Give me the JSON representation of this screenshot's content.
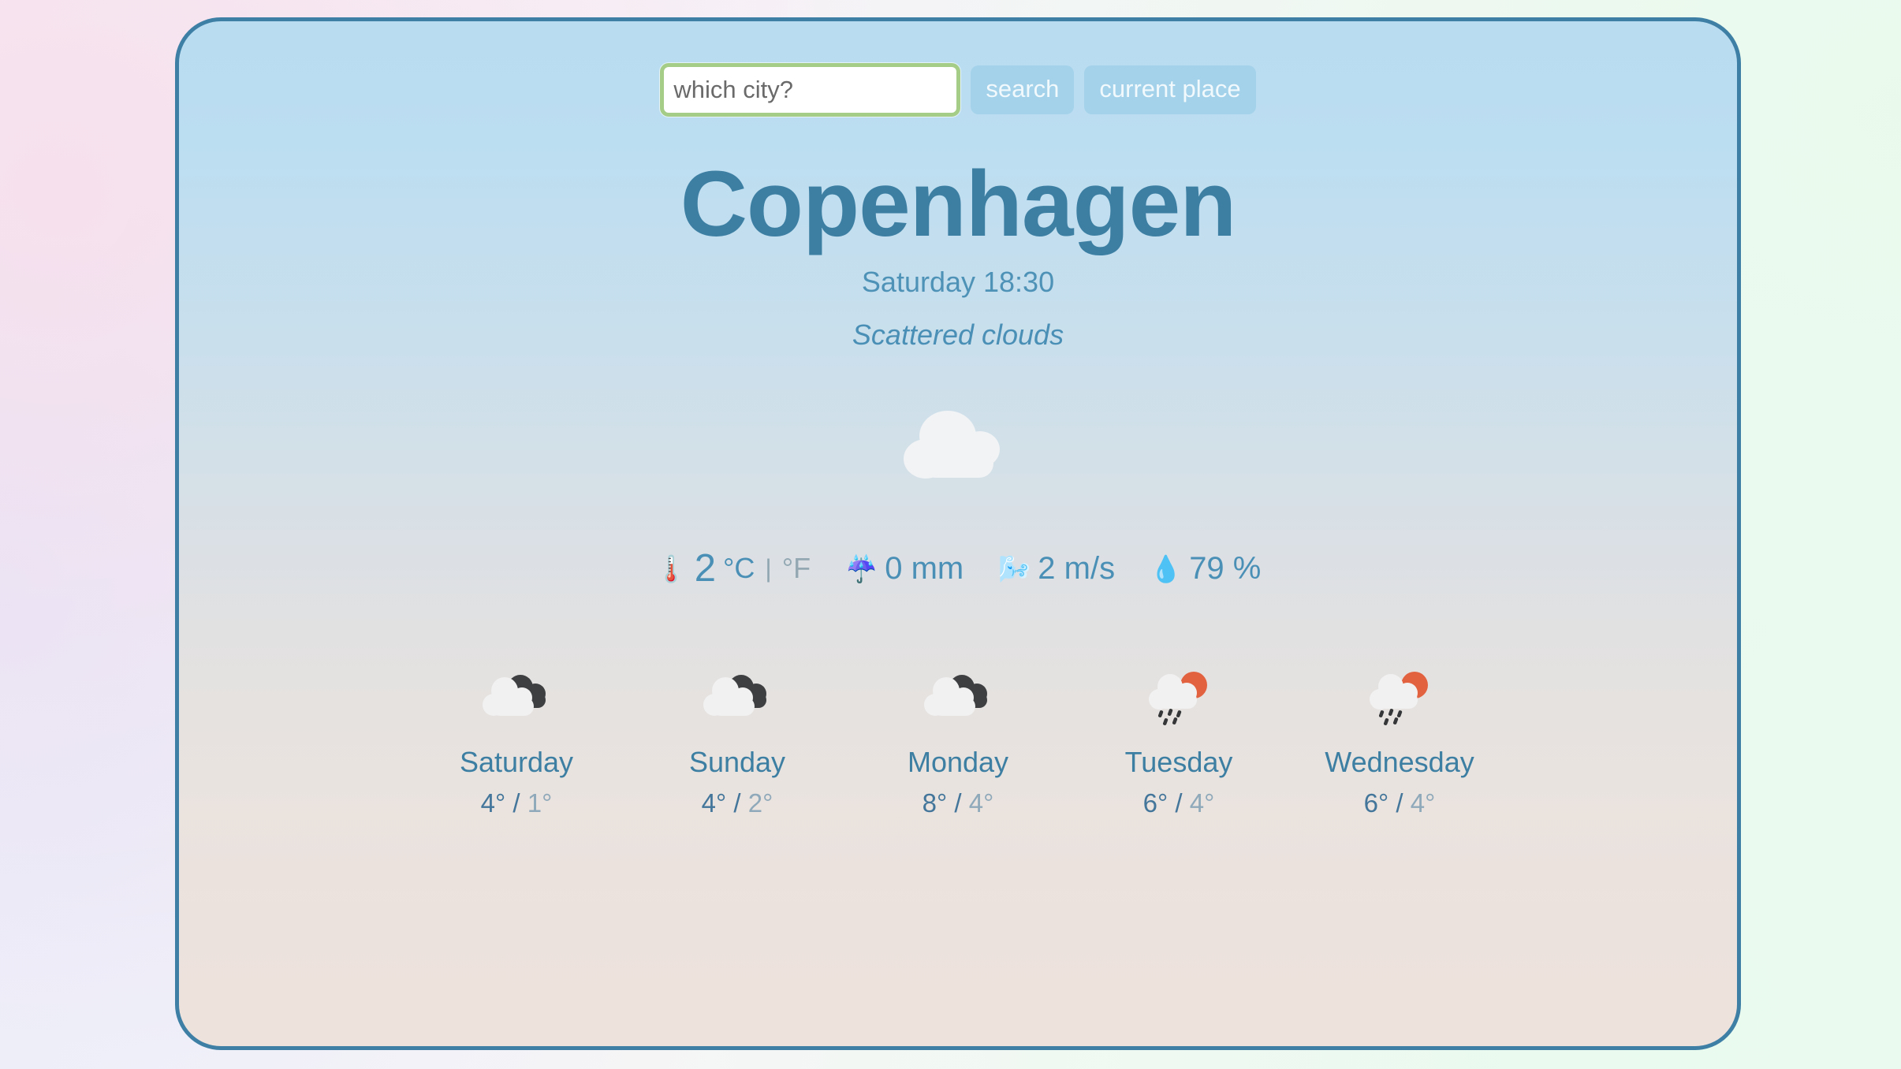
{
  "search": {
    "input_value": "",
    "placeholder": "which city?",
    "search_label": "search",
    "current_place_label": "current place",
    "input_icon": "text-cursor",
    "focus_color": "#a5cd88",
    "button_color": "#a3d2ea"
  },
  "current": {
    "city": "Copenhagen",
    "datetime": "Saturday 18:30",
    "description": "Scattered clouds",
    "icon": "cloud-icon",
    "temperature": "2",
    "unit_active": "°C",
    "unit_separator": "|",
    "unit_inactive": "°F",
    "precipitation": "0 mm",
    "precipitation_icon": "umbrella-rain-icon",
    "wind": "2 m/s",
    "wind_icon": "wind-face-icon",
    "humidity": "79 %",
    "humidity_icon": "water-droplet-icon",
    "temperature_icon": "thermometer-icon"
  },
  "forecast": [
    {
      "day": "Saturday",
      "icon": "cloudy-icon",
      "glyph": "☁",
      "high": "4°",
      "low": "1°",
      "separator": "/"
    },
    {
      "day": "Sunday",
      "icon": "cloudy-icon",
      "glyph": "☁",
      "high": "4°",
      "low": "2°",
      "separator": "/"
    },
    {
      "day": "Monday",
      "icon": "cloudy-icon",
      "glyph": "☁",
      "high": "8°",
      "low": "4°",
      "separator": "/"
    },
    {
      "day": "Tuesday",
      "icon": "sun-rain-icon",
      "glyph": "🌦",
      "high": "6°",
      "low": "4°",
      "separator": "/"
    },
    {
      "day": "Wednesday",
      "icon": "sun-rain-icon",
      "glyph": "🌦",
      "high": "6°",
      "low": "4°",
      "separator": "/"
    }
  ],
  "theme": {
    "card_border": "#3e7fa5",
    "accent_blue": "#3d7fa3",
    "metric_blue": "#4a90b6",
    "muted_blue": "#8fa9ba",
    "card_top": "#b9dcf1",
    "card_bottom": "#eee2dc"
  }
}
